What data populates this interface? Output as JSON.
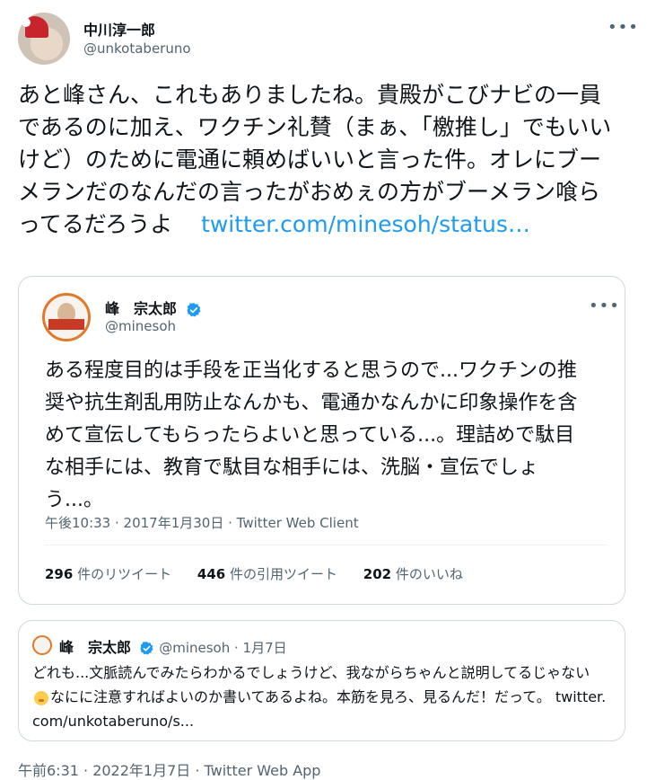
{
  "tweet": {
    "author_name": "中川淳一郎",
    "author_handle": "@unkotaberuno",
    "more_icon": "•••",
    "text": "あと峰さん、これもありましたね。貴殿がこびナビの一員であるのに加え、ワクチン礼賛（まぁ、「檄推し」でもいいけど）のために電通に頼めばいいと言った件。オレにブーメランだのなんだの言ったがおめぇの方がブーメラン喰らってるだろうよ",
    "link_text": "twitter.com/minesoh/status…",
    "timestamp": "午前6:31 · 2022年1月7日 · Twitter Web App"
  },
  "quoted": {
    "author_name": "峰　宗太郎",
    "author_handle": "@minesoh",
    "more_icon": "•••",
    "text": "ある程度目的は手段を正当化すると思うので...ワクチンの推奨や抗生剤乱用防止なんかも、電通かなんかに印象操作を含めて宣伝してもらったらよいと思っている...。理詰めで駄目な相手には、教育で駄目な相手には、洗脳・宣伝でしょう...。",
    "timestamp": "午後10:33 · 2017年1月30日 · Twitter Web Client",
    "stats": {
      "retweets_count": "296",
      "retweets_label": "件のリツイート",
      "quotes_count": "446",
      "quotes_label": "件の引用ツイート",
      "likes_count": "202",
      "likes_label": "件のいいね"
    }
  },
  "nested": {
    "author_name": "峰　宗太郎",
    "meta": "@minesoh · 1月7日",
    "text_before_emoji": "どれも...文脈読んでみたらわかるでしょうけど、我ながらちゃんと説明してるじゃない",
    "emoji": "emoji-icon",
    "text_after_emoji": "なにに注意すればよいのか書いてあるよね。本筋を見ろ、見るんだ！だって。",
    "link_text": "twitter.com/unkotaberuno/s..."
  },
  "colors": {
    "link": "#1d9bf0",
    "verified": "#1d9bf0",
    "secondary_text": "#536471",
    "border": "#cfd9de"
  }
}
